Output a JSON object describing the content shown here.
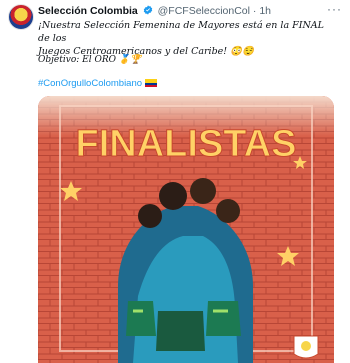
{
  "tweet": {
    "author_name": "Selección Colombia",
    "handle": "@FCFSeleccionCol",
    "separator": "·",
    "time": "1h",
    "more": "···",
    "line1": "¡Nuestra Selección Femenina de Mayores está en la FINAL de los",
    "line2": "Juegos Centroamericanos y del Caribe! 😳😌",
    "objective": "Objetivo: El ORO 🥇🏆",
    "hashtag": "#ConOrgulloColombiano",
    "image_title": "FINALISTAS"
  },
  "colors": {
    "link": "#1d9bf0",
    "verified": "#1d9bf0",
    "poster_bg": "#e76f51"
  }
}
